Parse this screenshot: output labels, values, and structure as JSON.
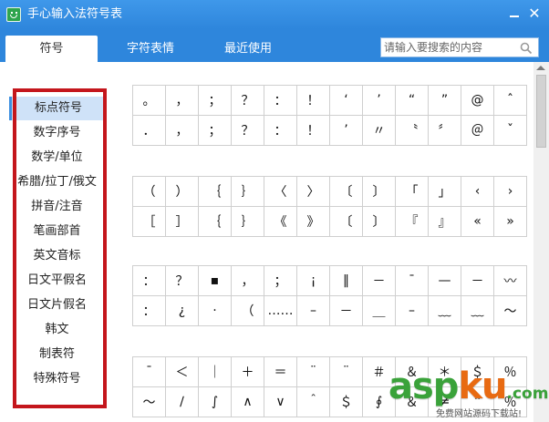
{
  "window": {
    "title": "手心输入法符号表",
    "icons": {
      "app": "smiley-app-icon",
      "minimize": "minimize-icon",
      "close": "close-icon"
    },
    "close_glyph": "✕"
  },
  "tabs": [
    {
      "label": "符号",
      "active": true
    },
    {
      "label": "字符表情",
      "active": false
    },
    {
      "label": "最近使用",
      "active": false
    }
  ],
  "search": {
    "placeholder": "请输入要搜索的内容",
    "value": "",
    "icon": "search-icon"
  },
  "sidebar": {
    "items": [
      {
        "label": "标点符号",
        "selected": true
      },
      {
        "label": "数字序号",
        "selected": false
      },
      {
        "label": "数学/单位",
        "selected": false
      },
      {
        "label": "希腊/拉丁/俄文",
        "selected": false
      },
      {
        "label": "拼音/注音",
        "selected": false
      },
      {
        "label": "笔画部首",
        "selected": false
      },
      {
        "label": "英文音标",
        "selected": false
      },
      {
        "label": "日文平假名",
        "selected": false
      },
      {
        "label": "日文片假名",
        "selected": false
      },
      {
        "label": "韩文",
        "selected": false
      },
      {
        "label": "制表符",
        "selected": false
      },
      {
        "label": "特殊符号",
        "selected": false
      }
    ]
  },
  "symbol_groups": [
    {
      "rows": [
        [
          "。",
          "，",
          "；",
          "？",
          "：",
          "！",
          "‘",
          "’",
          "“",
          "”",
          "@",
          "ˆ"
        ],
        [
          "．",
          "，",
          "；",
          "？",
          "：",
          "！",
          "’",
          "〃",
          "〝",
          "〞",
          "＠",
          "ˇ"
        ]
      ]
    },
    {
      "rows": [
        [
          "（",
          "）",
          "｛",
          "｝",
          "〈",
          "〉",
          "〔",
          "〕",
          "「",
          "」",
          "‹",
          "›"
        ],
        [
          "［",
          "］",
          "｛",
          "｝",
          "《",
          "》",
          "〔",
          "〕",
          "『",
          "』",
          "«",
          "»"
        ]
      ]
    },
    {
      "rows": [
        [
          "：",
          "？",
          "▪",
          "，",
          "；",
          "¡",
          "‖",
          "－",
          "¯",
          "—",
          "－",
          "〰"
        ],
        [
          "：",
          "¿",
          "·",
          "（",
          "……",
          "–",
          "－",
          "＿",
          "–",
          "﹏",
          "﹏",
          "～"
        ]
      ]
    },
    {
      "rows": [
        [
          "¯",
          "＜",
          "｜",
          "＋",
          "＝",
          "¨",
          "¨",
          "＃",
          "＆",
          "＊",
          "＄",
          "％"
        ],
        [
          "～",
          "∕",
          "∫",
          "∧",
          "∨",
          "＾",
          "＄",
          "∮",
          "＆",
          "≠",
          "＂",
          "％"
        ]
      ]
    }
  ],
  "watermark": {
    "logo_asp": "asp",
    "logo_ku": "ku",
    "logo_com": ".com",
    "subtitle": "免费网站源码下载站!"
  },
  "colors": {
    "title_bar": "#2e86dc",
    "selected_item_bg": "#cfe2f8",
    "annotation_frame": "#c4161c"
  }
}
